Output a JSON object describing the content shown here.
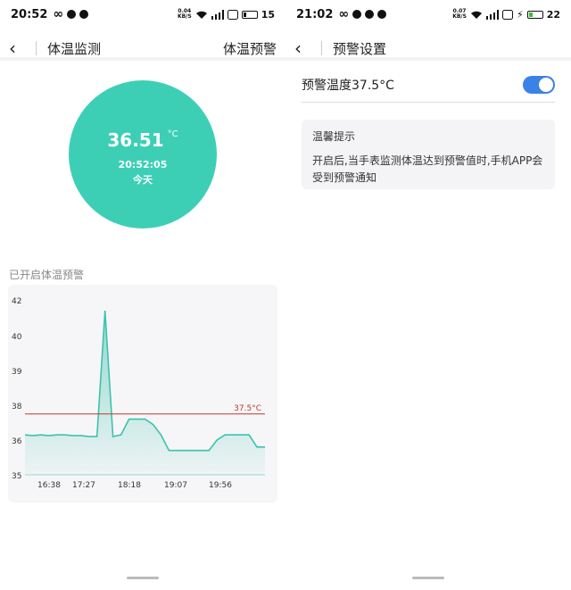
{
  "left": {
    "status": {
      "time": "20:52",
      "netspeed_top": "0.04",
      "netspeed_bottom": "KB/S",
      "battery": "15"
    },
    "nav": {
      "title": "体温监测",
      "action": "体温预警"
    },
    "reading": {
      "temperature": "36.51",
      "unit": "°C",
      "time": "20:52:05",
      "day": "今天"
    },
    "alert_label": "已开启体温预警",
    "chart_data": {
      "type": "area",
      "title": "",
      "xlabel": "",
      "ylabel": "",
      "ylim": [
        35,
        42
      ],
      "y_ticks": [
        "42",
        "40",
        "39",
        "38",
        "36",
        "35"
      ],
      "y_tick_values": [
        42,
        40,
        39,
        38,
        36,
        35
      ],
      "x_ticks": [
        "16:38",
        "17:27",
        "18:18",
        "19:07",
        "19:56"
      ],
      "threshold": {
        "value": 37.5,
        "label": "37.5°C",
        "color": "#c0392b"
      },
      "series": [
        {
          "color": "#3dc2ad",
          "values": [
            36.3,
            36.25,
            36.3,
            36.25,
            36.3,
            36.3,
            36.25,
            36.25,
            36.2,
            36.2,
            41.4,
            36.2,
            36.3,
            37.2,
            37.2,
            37.2,
            36.9,
            36.3,
            35.7,
            35.7,
            35.7,
            35.7,
            35.7,
            35.7,
            36.0,
            36.3,
            36.3,
            36.3,
            36.3,
            35.8,
            35.8
          ]
        }
      ]
    }
  },
  "right": {
    "status": {
      "time": "21:02",
      "netspeed_top": "0.07",
      "netspeed_bottom": "KB/S",
      "battery": "22"
    },
    "nav": {
      "title": "预警设置"
    },
    "setting": {
      "label": "预警温度37.5°C",
      "enabled": true
    },
    "tip": {
      "title": "温馨提示",
      "body": "开启后,当手表监测体温达到预警值时,手机APP会受到预警通知"
    }
  },
  "colors": {
    "accent": "#3dcfb6",
    "toggle": "#3b82e6"
  }
}
